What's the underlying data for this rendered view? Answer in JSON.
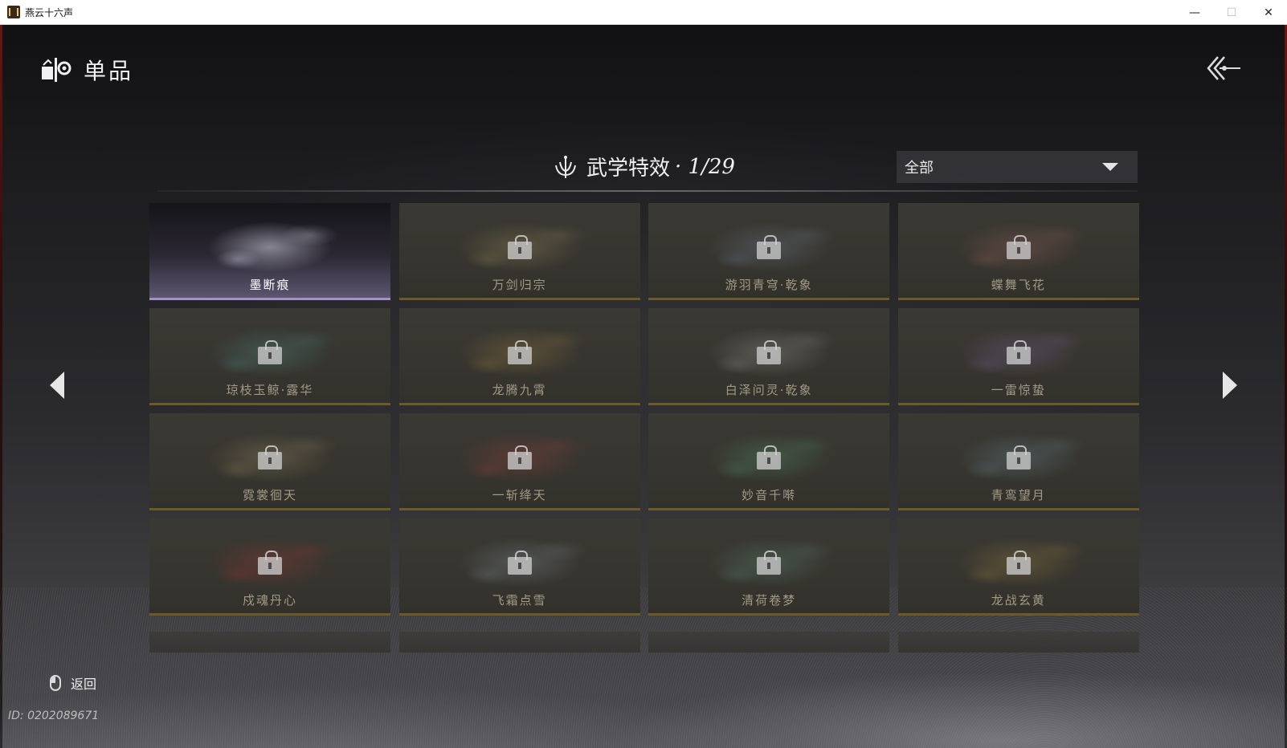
{
  "window": {
    "title": "燕云十六声",
    "minimize": "—",
    "maximize": "☐",
    "close": "✕"
  },
  "header": {
    "title": "单品",
    "icon": "item-icon",
    "back_icon": "back-arrow-icon"
  },
  "section": {
    "title": "武学特效",
    "count": "· 1/29",
    "icon": "lotus-emblem-icon"
  },
  "filter": {
    "selected": "全部",
    "icon": "caret-down-icon"
  },
  "cards": [
    {
      "label": "墨断痕",
      "locked": false,
      "selected": true,
      "color": "#d8d8e8"
    },
    {
      "label": "万剑归宗",
      "locked": true,
      "selected": false,
      "color": "#c9b373"
    },
    {
      "label": "游羽青穹·乾象",
      "locked": true,
      "selected": false,
      "color": "#8fa2c8"
    },
    {
      "label": "蝶舞飞花",
      "locked": true,
      "selected": false,
      "color": "#c97a76"
    },
    {
      "label": "琼枝玉鲸·露华",
      "locked": true,
      "selected": false,
      "color": "#5fb8b0"
    },
    {
      "label": "龙腾九霄",
      "locked": true,
      "selected": false,
      "color": "#c9a44e"
    },
    {
      "label": "白泽问灵·乾象",
      "locked": true,
      "selected": false,
      "color": "#c9c9c9"
    },
    {
      "label": "一雷惊蛰",
      "locked": true,
      "selected": false,
      "color": "#9a7fd0"
    },
    {
      "label": "霓裳徊天",
      "locked": true,
      "selected": false,
      "color": "#c9b07a"
    },
    {
      "label": "一斩绛天",
      "locked": true,
      "selected": false,
      "color": "#c94a4a"
    },
    {
      "label": "妙音千啭",
      "locked": true,
      "selected": false,
      "color": "#5fbf8a"
    },
    {
      "label": "青鸾望月",
      "locked": true,
      "selected": false,
      "color": "#7fb0c9"
    },
    {
      "label": "戍魂丹心",
      "locked": true,
      "selected": false,
      "color": "#d03a3a"
    },
    {
      "label": "飞霜点雪",
      "locked": true,
      "selected": false,
      "color": "#a9bccf"
    },
    {
      "label": "清荷卷梦",
      "locked": true,
      "selected": false,
      "color": "#6fb59a"
    },
    {
      "label": "龙战玄黄",
      "locked": true,
      "selected": false,
      "color": "#c9a44e"
    }
  ],
  "partial_cards_count": 4,
  "nav": {
    "prev_icon": "chevron-left-icon",
    "next_icon": "chevron-right-icon"
  },
  "footer": {
    "back_label": "返回",
    "mouse_icon": "mouse-right-click-icon",
    "user_id": "ID: 0202089671"
  }
}
